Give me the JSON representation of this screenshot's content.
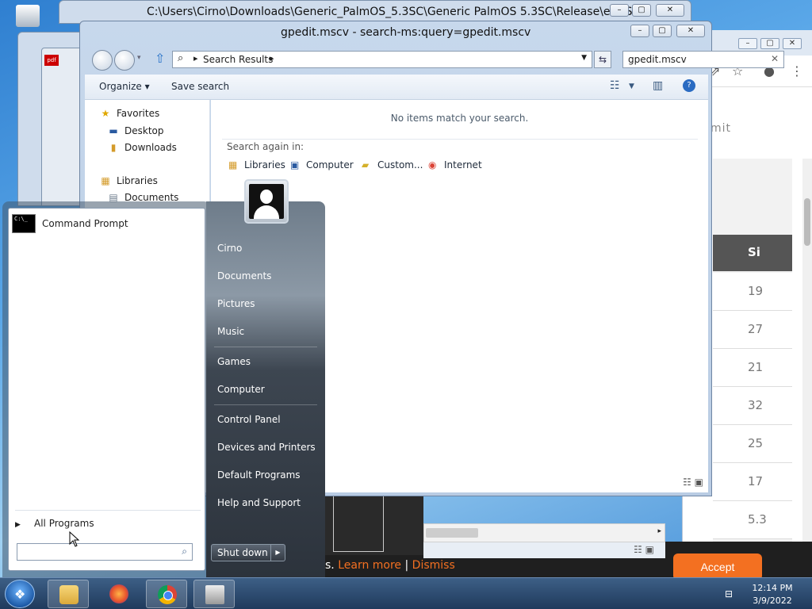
{
  "back_window": {
    "title": "C:\\Users\\Cirno\\Downloads\\Generic_PalmOS_5.3SC\\Generic PalmOS 5.3SC\\Release\\enUS"
  },
  "browser": {
    "partial_text": "mit",
    "table_header": "Si",
    "table_rows": [
      "19",
      "27",
      "21",
      "32",
      "25",
      "17",
      "5.3"
    ],
    "cookie_text": "s. ",
    "learn_more": "Learn more",
    "separator": " | ",
    "dismiss": "Dismiss",
    "accept": "Accept"
  },
  "explorer": {
    "title": "gpedit.mscv - search-ms:query=gpedit.mscv",
    "address_crumb": "Search Results",
    "search_value": "gpedit.mscv",
    "commands": {
      "organize": "Organize",
      "save_search": "Save search"
    },
    "nav": {
      "favorites": "Favorites",
      "desktop": "Desktop",
      "downloads": "Downloads",
      "libraries": "Libraries",
      "documents": "Documents"
    },
    "no_items": "No items match your search.",
    "search_again": "Search again in:",
    "locations": [
      "Libraries",
      "Computer",
      "Custom...",
      "Internet"
    ]
  },
  "start_menu": {
    "program": "Command Prompt",
    "all_programs": "All Programs",
    "search_value": "",
    "links": [
      "Cirno",
      "Documents",
      "Pictures",
      "Music",
      "Games",
      "Computer",
      "Control Panel",
      "Devices and Printers",
      "Default Programs",
      "Help and Support"
    ],
    "shutdown": "Shut down"
  },
  "taskbar": {
    "time": "12:14 PM",
    "date": "3/9/2022"
  }
}
